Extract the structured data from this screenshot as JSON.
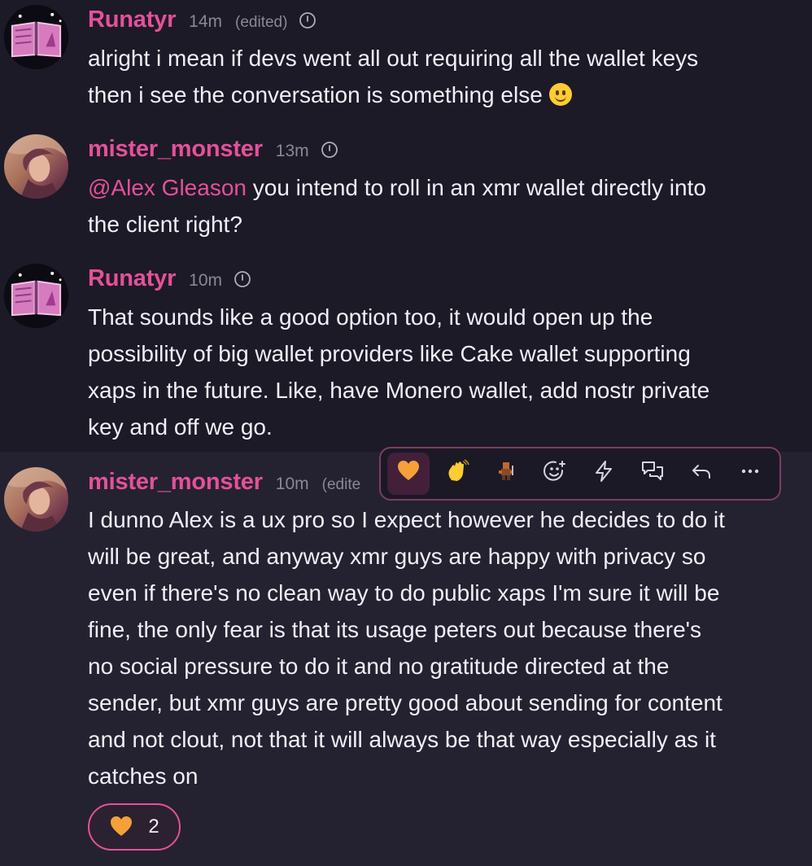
{
  "messages": [
    {
      "author": "Runatyr",
      "time": "14m",
      "edited": "(edited)",
      "lines": [
        "alright i mean if devs went all out requiring all the wallet keys",
        "then i see the conversation is something else"
      ],
      "trailing_emoji": "slightly-smiling-face-emoji"
    },
    {
      "author": "mister_monster",
      "time": "13m",
      "mention": "@Alex Gleason",
      "lines": [
        " you intend to roll in an xmr wallet directly into",
        "the client right?"
      ]
    },
    {
      "author": "Runatyr",
      "time": "10m",
      "lines": [
        "That sounds like a good option too, it would open up the",
        "possibility of big wallet providers like Cake wallet supporting",
        "xaps in the future. Like, have Monero wallet, add nostr private",
        "key and off we go."
      ]
    },
    {
      "author": "mister_monster",
      "time": "10m",
      "edited": "(edite",
      "lines": [
        "I dunno Alex is a ux pro so I expect however he decides to do it",
        "will be great, and anyway xmr guys are happy with privacy so",
        "even if there's no clean way to do public xaps I'm sure it will be",
        "fine, the only fear is that its usage peters out because there's",
        "no social pressure to do it and no gratitude directed at the",
        "sender, but xmr guys are pretty good about sending for content",
        "and not clout, not that it will always be that way especially as it",
        "catches on"
      ],
      "reaction": {
        "emoji": "orange-heart-icon",
        "count": "2"
      }
    }
  ],
  "toolbar": {
    "buttons": [
      {
        "name": "react-orange-heart-button",
        "icon": "orange-heart-icon",
        "glyph": "🧡"
      },
      {
        "name": "react-wave-button",
        "icon": "waving-hand-icon",
        "glyph": "👋"
      },
      {
        "name": "react-custom-emoji-button",
        "icon": "pixel-character-icon",
        "glyph": ""
      },
      {
        "name": "add-reaction-button",
        "icon": "smiley-plus-icon",
        "glyph": ""
      },
      {
        "name": "zap-button",
        "icon": "lightning-icon",
        "glyph": ""
      },
      {
        "name": "reply-in-thread-button",
        "icon": "chat-bubbles-icon",
        "glyph": ""
      },
      {
        "name": "reply-button",
        "icon": "reply-arrow-icon",
        "glyph": ""
      },
      {
        "name": "more-options-button",
        "icon": "ellipsis-icon",
        "glyph": ""
      }
    ]
  },
  "colors": {
    "background": "#1c1a27",
    "hover_background": "#242230",
    "accent": "#e5509a",
    "muted": "#8b8797",
    "text": "#f1eef6",
    "toolbar_border": "#7c3d63"
  }
}
